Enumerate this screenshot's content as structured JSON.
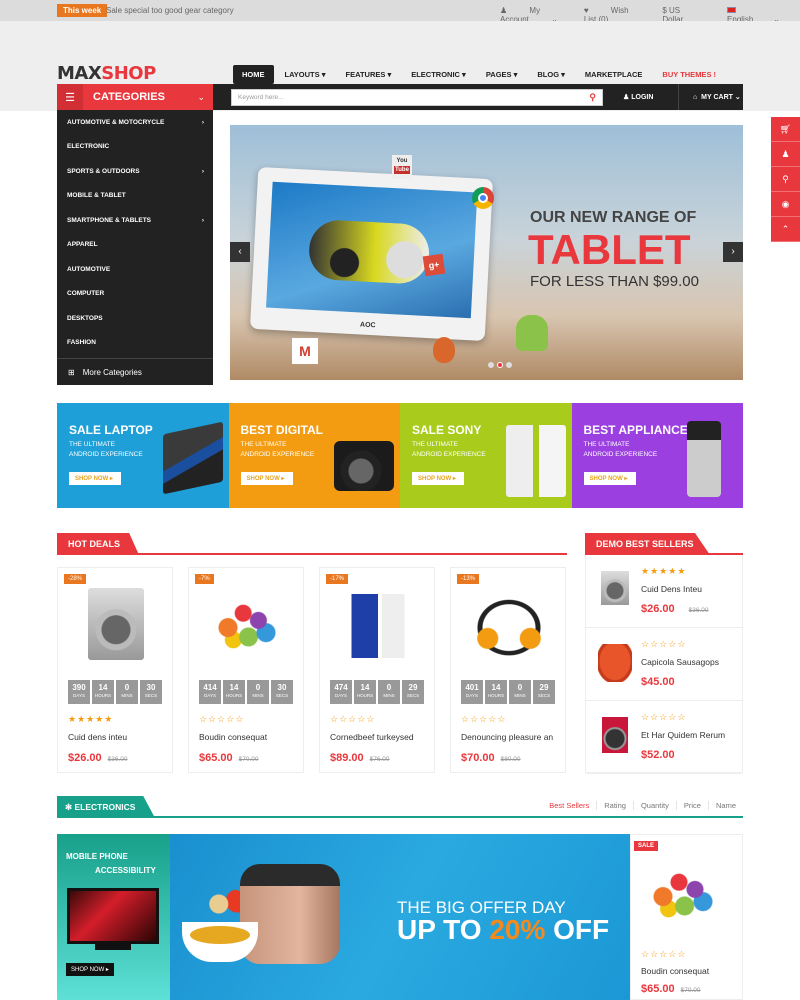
{
  "topbar": {
    "badge": "This week",
    "promo": "Sale special too good gear category",
    "account": "My Account",
    "wishlist": "Wish List (0)",
    "currency": "$ US Dollar",
    "language": "English"
  },
  "header": {
    "logo_part1": "MAX",
    "logo_part2": "SHOP",
    "nav": [
      {
        "label": "HOME",
        "active": true
      },
      {
        "label": "LAYOUTS ▾"
      },
      {
        "label": "FEATURES ▾"
      },
      {
        "label": "ELECTRONIC ▾"
      },
      {
        "label": "PAGES ▾"
      },
      {
        "label": "BLOG ▾"
      },
      {
        "label": "MARKETPLACE"
      },
      {
        "label": "BUY THEMES !"
      }
    ]
  },
  "categories": {
    "title": "CATEGORIES",
    "items": [
      {
        "label": "AUTOMOTIVE & MOTOCRYCLE",
        "sub": "›"
      },
      {
        "label": "ELECTRONIC",
        "sub": ""
      },
      {
        "label": "SPORTS & OUTDOORS",
        "sub": "›"
      },
      {
        "label": "MOBILE & TABLET",
        "sub": ""
      },
      {
        "label": "SMARTPHONE & TABLETS",
        "sub": "›"
      },
      {
        "label": "APPAREL",
        "sub": ""
      },
      {
        "label": "AUTOMOTIVE",
        "sub": ""
      },
      {
        "label": "COMPUTER",
        "sub": ""
      },
      {
        "label": "DESKTOPS",
        "sub": ""
      },
      {
        "label": "FASHION",
        "sub": ""
      }
    ],
    "more": "More Categories"
  },
  "search": {
    "placeholder": "Keyword here...",
    "login": "LOGIN",
    "cart": "MY CART"
  },
  "slider": {
    "line1": "OUR NEW RANGE OF",
    "line2": "TABLET",
    "line3": "FOR LESS THAN $99.00",
    "monitor_brand": "AOC",
    "prev": "‹",
    "next": "›"
  },
  "banners": [
    {
      "title": "SALE LAPTOP",
      "sub1": "THE ULTIMATE",
      "sub2": "ANDROID EXPERIENCE",
      "button": "SHOP NOW ▸",
      "color": "#1e9fd8"
    },
    {
      "title": "BEST DIGITAL",
      "sub1": "THE ULTIMATE",
      "sub2": "ANDROID EXPERIENCE",
      "button": "SHOP NOW ▸",
      "color": "#f39c12"
    },
    {
      "title": "SALE SONY",
      "sub1": "THE ULTIMATE",
      "sub2": "ANDROID EXPERIENCE",
      "button": "SHOP NOW ▸",
      "color": "#a9cc1c"
    },
    {
      "title": "BEST APPLIANCES",
      "sub1": "THE ULTIMATE",
      "sub2": "ANDROID EXPERIENCE",
      "button": "SHOP NOW ▸",
      "color": "#9b3fe0"
    }
  ],
  "hot_deals": {
    "title": "HOT DEALS",
    "products": [
      {
        "discount": "-28%",
        "days": "390",
        "hours": "14",
        "mins": "0",
        "secs": "30",
        "rating": 5,
        "name": "Cuid dens inteu",
        "price": "$26.00",
        "old_price": "$36.00"
      },
      {
        "discount": "-7%",
        "days": "414",
        "hours": "14",
        "mins": "0",
        "secs": "30",
        "rating": 0,
        "name": "Boudin consequat",
        "price": "$65.00",
        "old_price": "$70.00"
      },
      {
        "discount": "-17%",
        "days": "474",
        "hours": "14",
        "mins": "0",
        "secs": "29",
        "rating": 0,
        "name": "Cornedbeef turkeysed",
        "price": "$89.00",
        "old_price": "$76.00"
      },
      {
        "discount": "-13%",
        "days": "401",
        "hours": "14",
        "mins": "0",
        "secs": "29",
        "rating": 0,
        "name": "Denouncing pleasure an",
        "price": "$70.00",
        "old_price": "$80.00"
      }
    ],
    "labels": {
      "days": "DAYS",
      "hours": "HOURS",
      "mins": "MINS",
      "secs": "SECS"
    }
  },
  "best_sellers": {
    "title": "DEMO BEST SELLERS",
    "items": [
      {
        "name": "Cuid Dens Inteu",
        "price": "$26.00",
        "old_price": "$36.00",
        "rating": 5
      },
      {
        "name": "Capicola Sausagops",
        "price": "$45.00",
        "old_price": "",
        "rating": 0
      },
      {
        "name": "Et Har Quidem Rerum",
        "price": "$52.00",
        "old_price": "",
        "rating": 0
      }
    ]
  },
  "electronics": {
    "title": "ELECTRONICS",
    "sorts": [
      "Best Sellers",
      "Rating",
      "Quantity",
      "Price",
      "Name"
    ],
    "left_title1": "MOBILE PHONE",
    "left_title2": "ACCESSIBILITY",
    "left_button": "SHOP NOW ▸",
    "offer_line1": "THE BIG OFFER DAY",
    "offer_prefix": "UP TO ",
    "offer_highlight": "20%",
    "offer_suffix": " OFF",
    "product": {
      "badge": "SALE",
      "name": "Boudin consequat",
      "price": "$65.00",
      "old_price": "$70.00",
      "rating": 0
    }
  },
  "colors": {
    "accent": "#e8383d",
    "orange": "#e8771f",
    "teal": "#17a08a",
    "dark": "#222222"
  }
}
